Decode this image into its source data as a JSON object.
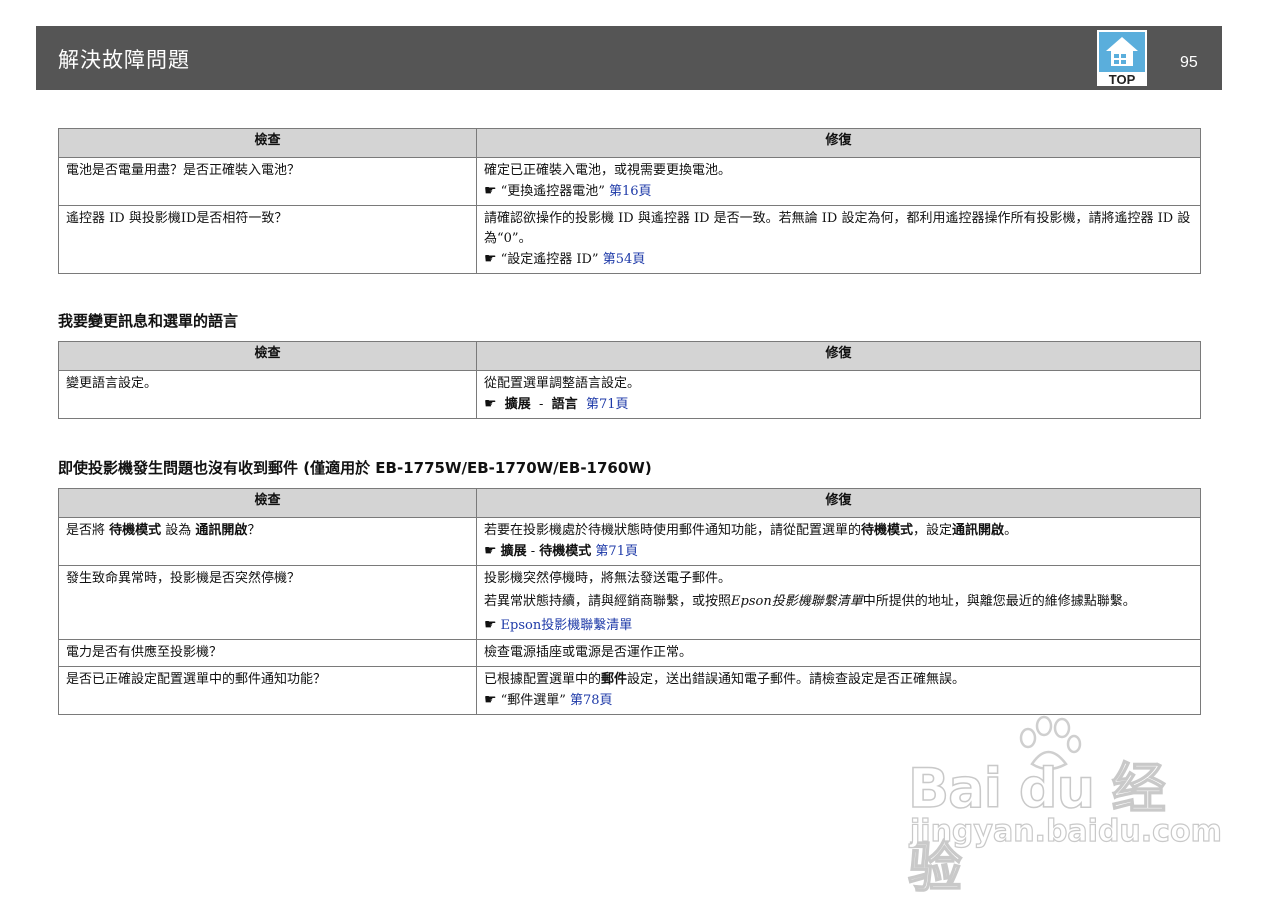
{
  "header": {
    "title": "解決故障問題",
    "top_label": "TOP",
    "page_number": "95"
  },
  "columns": {
    "check": "檢查",
    "fix": "修復"
  },
  "table1": {
    "rows": [
      {
        "check": "電池是否電量用盡？是否正確裝入電池？",
        "fix_text": "確定已正確裝入電池，或視需要更換電池。",
        "ref_quote": "“更換遙控器電池”",
        "ref_link": "第16頁"
      },
      {
        "check": "遙控器 ID 與投影機ID是否相符一致？",
        "fix_text": "請確認欲操作的投影機 ID 與遙控器 ID 是否一致。若無論 ID 設定為何，都利用遙控器操作所有投影機，請將遙控器 ID 設為“0”。",
        "ref_quote": "“設定遙控器 ID”",
        "ref_link": "第54頁"
      }
    ]
  },
  "section2": {
    "title": "我要變更訊息和選單的語言",
    "row": {
      "check": "變更語言設定。",
      "fix_text": "從配置選單調整語言設定。",
      "ref_menu1": "擴展",
      "ref_sep": "-",
      "ref_menu2": "語言",
      "ref_link": "第71頁"
    }
  },
  "section3": {
    "title": "即使投影機發生問題也沒有收到郵件 (僅適用於 EB-1775W/EB-1770W/EB-1760W)",
    "row1": {
      "check_pre": "是否將 ",
      "check_b1": "待機模式",
      "check_mid": " 設為 ",
      "check_b2": "通訊開啟",
      "check_post": "？",
      "fix_pre": "若要在投影機處於待機狀態時使用郵件通知功能，請從配置選單的",
      "fix_b1": "待機模式",
      "fix_mid": "，設定",
      "fix_b2": "通訊開啟",
      "fix_post": "。",
      "ref_menu1": "擴展",
      "ref_sep": "-",
      "ref_menu2": "待機模式",
      "ref_link": "第71頁"
    },
    "row2": {
      "check": "發生致命異常時，投影機是否突然停機？",
      "fix_line1": "投影機突然停機時，將無法發送電子郵件。",
      "fix_line2_pre": "若異常狀態持續，請與經銷商聯繫，或按照",
      "fix_line2_it": "Epson投影機聯繫清單",
      "fix_line2_post": "中所提供的地址，與離您最近的維修據點聯繫。",
      "ref_link": "Epson投影機聯繫清單"
    },
    "row3": {
      "check": "電力是否有供應至投影機？",
      "fix": "檢查電源插座或電源是否運作正常。"
    },
    "row4": {
      "check": "是否已正確設定配置選單中的郵件通知功能？",
      "fix_pre": "已根據配置選單中的",
      "fix_b": "郵件",
      "fix_post": "設定，送出錯誤通知電子郵件。請檢查設定是否正確無誤。",
      "ref_quote": "“郵件選單”",
      "ref_link": "第78頁"
    }
  },
  "watermark": {
    "main": "Bai du 经验",
    "sub": "jingyan.baidu.com"
  },
  "colors": {
    "header_bg": "#555555",
    "table_header_bg": "#d4d4d4",
    "link": "#1e3aa8",
    "top_icon": "#5aaedc"
  }
}
